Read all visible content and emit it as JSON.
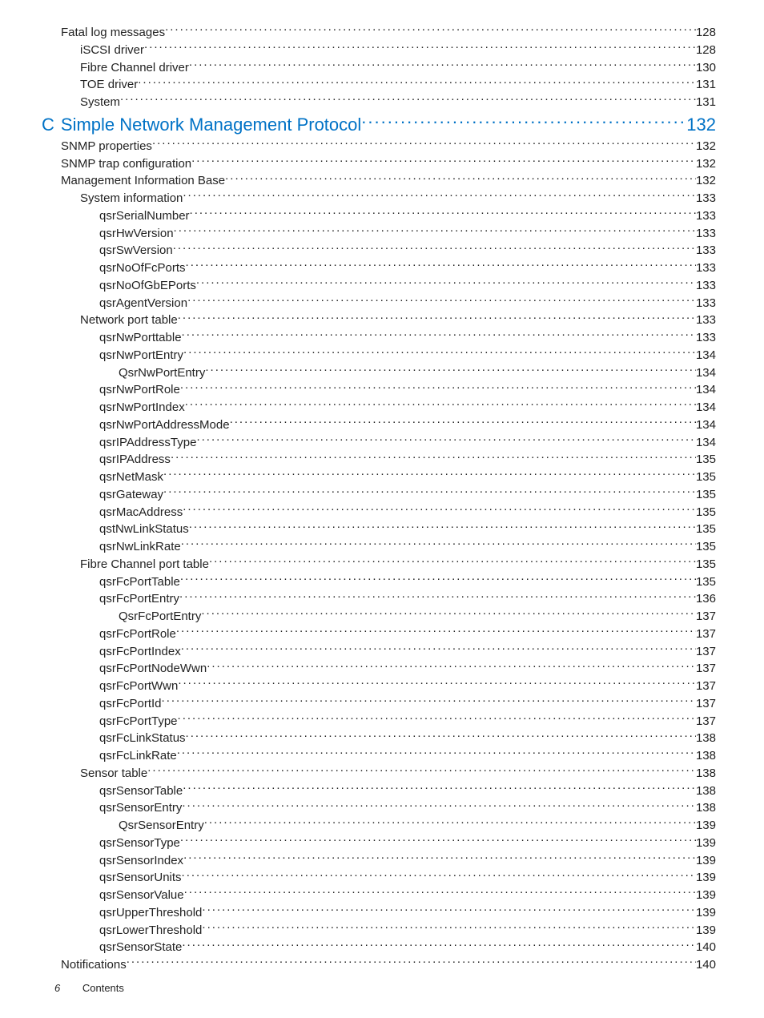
{
  "toc": [
    {
      "level": "lvl-1",
      "prefix": "",
      "title": "Fatal log messages",
      "page": "128"
    },
    {
      "level": "lvl-2",
      "prefix": "",
      "title": "iSCSI driver",
      "page": "128"
    },
    {
      "level": "lvl-2",
      "prefix": "",
      "title": "Fibre Channel driver",
      "page": "130"
    },
    {
      "level": "lvl-2",
      "prefix": "",
      "title": "TOE driver",
      "page": "131"
    },
    {
      "level": "lvl-2",
      "prefix": "",
      "title": "System",
      "page": "131"
    },
    {
      "level": "lvl-h1",
      "prefix": "C",
      "title": "Simple Network Management Protocol",
      "page": "132"
    },
    {
      "level": "lvl-1",
      "prefix": "",
      "title": "SNMP properties",
      "page": "132"
    },
    {
      "level": "lvl-1",
      "prefix": "",
      "title": "SNMP trap configuration",
      "page": "132"
    },
    {
      "level": "lvl-1",
      "prefix": "",
      "title": "Management Information Base ",
      "page": "132"
    },
    {
      "level": "lvl-2",
      "prefix": "",
      "title": "System information",
      "page": "133"
    },
    {
      "level": "lvl-3",
      "prefix": "",
      "title": "qsrSerialNumber",
      "page": "133"
    },
    {
      "level": "lvl-3",
      "prefix": "",
      "title": "qsrHwVersion",
      "page": "133"
    },
    {
      "level": "lvl-3",
      "prefix": "",
      "title": "qsrSwVersion",
      "page": "133"
    },
    {
      "level": "lvl-3",
      "prefix": "",
      "title": "qsrNoOfFcPorts",
      "page": "133"
    },
    {
      "level": "lvl-3",
      "prefix": "",
      "title": "qsrNoOfGbEPorts",
      "page": "133"
    },
    {
      "level": "lvl-3",
      "prefix": "",
      "title": "qsrAgentVersion",
      "page": "133"
    },
    {
      "level": "lvl-2",
      "prefix": "",
      "title": "Network port table",
      "page": "133"
    },
    {
      "level": "lvl-3",
      "prefix": "",
      "title": "qsrNwPorttable",
      "page": "133"
    },
    {
      "level": "lvl-3",
      "prefix": "",
      "title": "qsrNwPortEntry",
      "page": "134"
    },
    {
      "level": "lvl-4",
      "prefix": "",
      "title": "QsrNwPortEntry",
      "page": "134"
    },
    {
      "level": "lvl-3",
      "prefix": "",
      "title": "qsrNwPortRole",
      "page": "134"
    },
    {
      "level": "lvl-3",
      "prefix": "",
      "title": "qsrNwPortIndex",
      "page": "134"
    },
    {
      "level": "lvl-3",
      "prefix": "",
      "title": "qsrNwPortAddressMode",
      "page": "134"
    },
    {
      "level": "lvl-3",
      "prefix": "",
      "title": "qsrIPAddressType",
      "page": "134"
    },
    {
      "level": "lvl-3",
      "prefix": "",
      "title": "qsrIPAddress",
      "page": "135"
    },
    {
      "level": "lvl-3",
      "prefix": "",
      "title": "qsrNetMask",
      "page": "135"
    },
    {
      "level": "lvl-3",
      "prefix": "",
      "title": "qsrGateway",
      "page": "135"
    },
    {
      "level": "lvl-3",
      "prefix": "",
      "title": "qsrMacAddress",
      "page": "135"
    },
    {
      "level": "lvl-3",
      "prefix": "",
      "title": "qstNwLinkStatus",
      "page": "135"
    },
    {
      "level": "lvl-3",
      "prefix": "",
      "title": "qsrNwLinkRate",
      "page": "135"
    },
    {
      "level": "lvl-2",
      "prefix": "",
      "title": "Fibre Channel port table",
      "page": "135"
    },
    {
      "level": "lvl-3",
      "prefix": "",
      "title": "qsrFcPortTable",
      "page": "135"
    },
    {
      "level": "lvl-3",
      "prefix": "",
      "title": "qsrFcPortEntry",
      "page": "136"
    },
    {
      "level": "lvl-4",
      "prefix": "",
      "title": "QsrFcPortEntry",
      "page": "137"
    },
    {
      "level": "lvl-3",
      "prefix": "",
      "title": "qsrFcPortRole",
      "page": "137"
    },
    {
      "level": "lvl-3",
      "prefix": "",
      "title": "qsrFcPortIndex",
      "page": "137"
    },
    {
      "level": "lvl-3",
      "prefix": "",
      "title": "qsrFcPortNodeWwn",
      "page": "137"
    },
    {
      "level": "lvl-3",
      "prefix": "",
      "title": "qsrFcPortWwn",
      "page": "137"
    },
    {
      "level": "lvl-3",
      "prefix": "",
      "title": "qsrFcPortId",
      "page": "137"
    },
    {
      "level": "lvl-3",
      "prefix": "",
      "title": "qsrFcPortType",
      "page": "137"
    },
    {
      "level": "lvl-3",
      "prefix": "",
      "title": "qsrFcLinkStatus",
      "page": "138"
    },
    {
      "level": "lvl-3",
      "prefix": "",
      "title": "qsrFcLinkRate",
      "page": "138"
    },
    {
      "level": "lvl-2",
      "prefix": "",
      "title": "Sensor table",
      "page": "138"
    },
    {
      "level": "lvl-3",
      "prefix": "",
      "title": "qsrSensorTable",
      "page": "138"
    },
    {
      "level": "lvl-3",
      "prefix": "",
      "title": "qsrSensorEntry",
      "page": "138"
    },
    {
      "level": "lvl-4",
      "prefix": "",
      "title": "QsrSensorEntry",
      "page": "139"
    },
    {
      "level": "lvl-3",
      "prefix": "",
      "title": "qsrSensorType",
      "page": "139"
    },
    {
      "level": "lvl-3",
      "prefix": "",
      "title": "qsrSensorIndex",
      "page": "139"
    },
    {
      "level": "lvl-3",
      "prefix": "",
      "title": "qsrSensorUnits",
      "page": "139"
    },
    {
      "level": "lvl-3",
      "prefix": "",
      "title": "qsrSensorValue",
      "page": "139"
    },
    {
      "level": "lvl-3",
      "prefix": "",
      "title": "qsrUpperThreshold",
      "page": "139"
    },
    {
      "level": "lvl-3",
      "prefix": "",
      "title": "qsrLowerThreshold",
      "page": "139"
    },
    {
      "level": "lvl-3",
      "prefix": "",
      "title": "qsrSensorState",
      "page": "140"
    },
    {
      "level": "lvl-1",
      "prefix": "",
      "title": "Notifications",
      "page": "140"
    }
  ],
  "footer": {
    "pageNum": "6",
    "section": "Contents"
  }
}
